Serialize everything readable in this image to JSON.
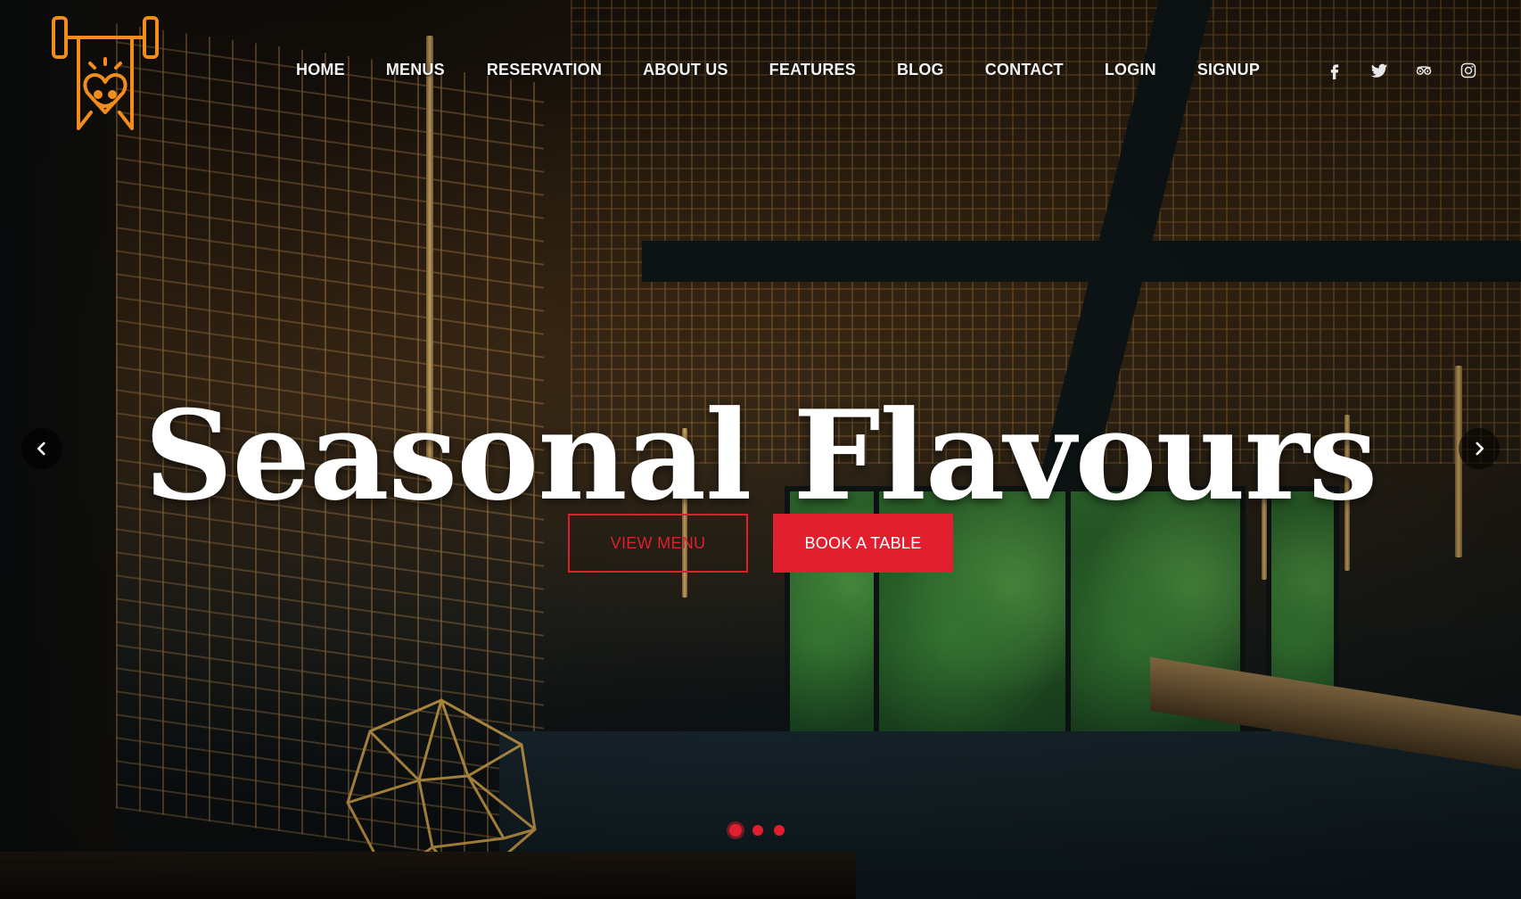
{
  "brand": {
    "logo_icon": "barbell-heart-logo-icon",
    "logo_color": "#f28c1c"
  },
  "nav": {
    "items": [
      {
        "label": "HOME"
      },
      {
        "label": "MENUS"
      },
      {
        "label": "RESERVATION"
      },
      {
        "label": "ABOUT US"
      },
      {
        "label": "FEATURES"
      },
      {
        "label": "BLOG"
      },
      {
        "label": "CONTACT"
      },
      {
        "label": "LOGIN"
      },
      {
        "label": "SIGNUP"
      }
    ]
  },
  "social": {
    "icons": [
      "facebook-icon",
      "twitter-icon",
      "tripadvisor-icon",
      "instagram-icon"
    ]
  },
  "hero": {
    "title": "Seasonal Flavours",
    "primary_button": "VIEW MENU",
    "secondary_button": "BOOK A TABLE",
    "accent_color": "#e21f2f"
  },
  "carousel": {
    "prev_icon": "chevron-left-icon",
    "next_icon": "chevron-right-icon",
    "slide_count": 3,
    "active_slide": 1
  }
}
